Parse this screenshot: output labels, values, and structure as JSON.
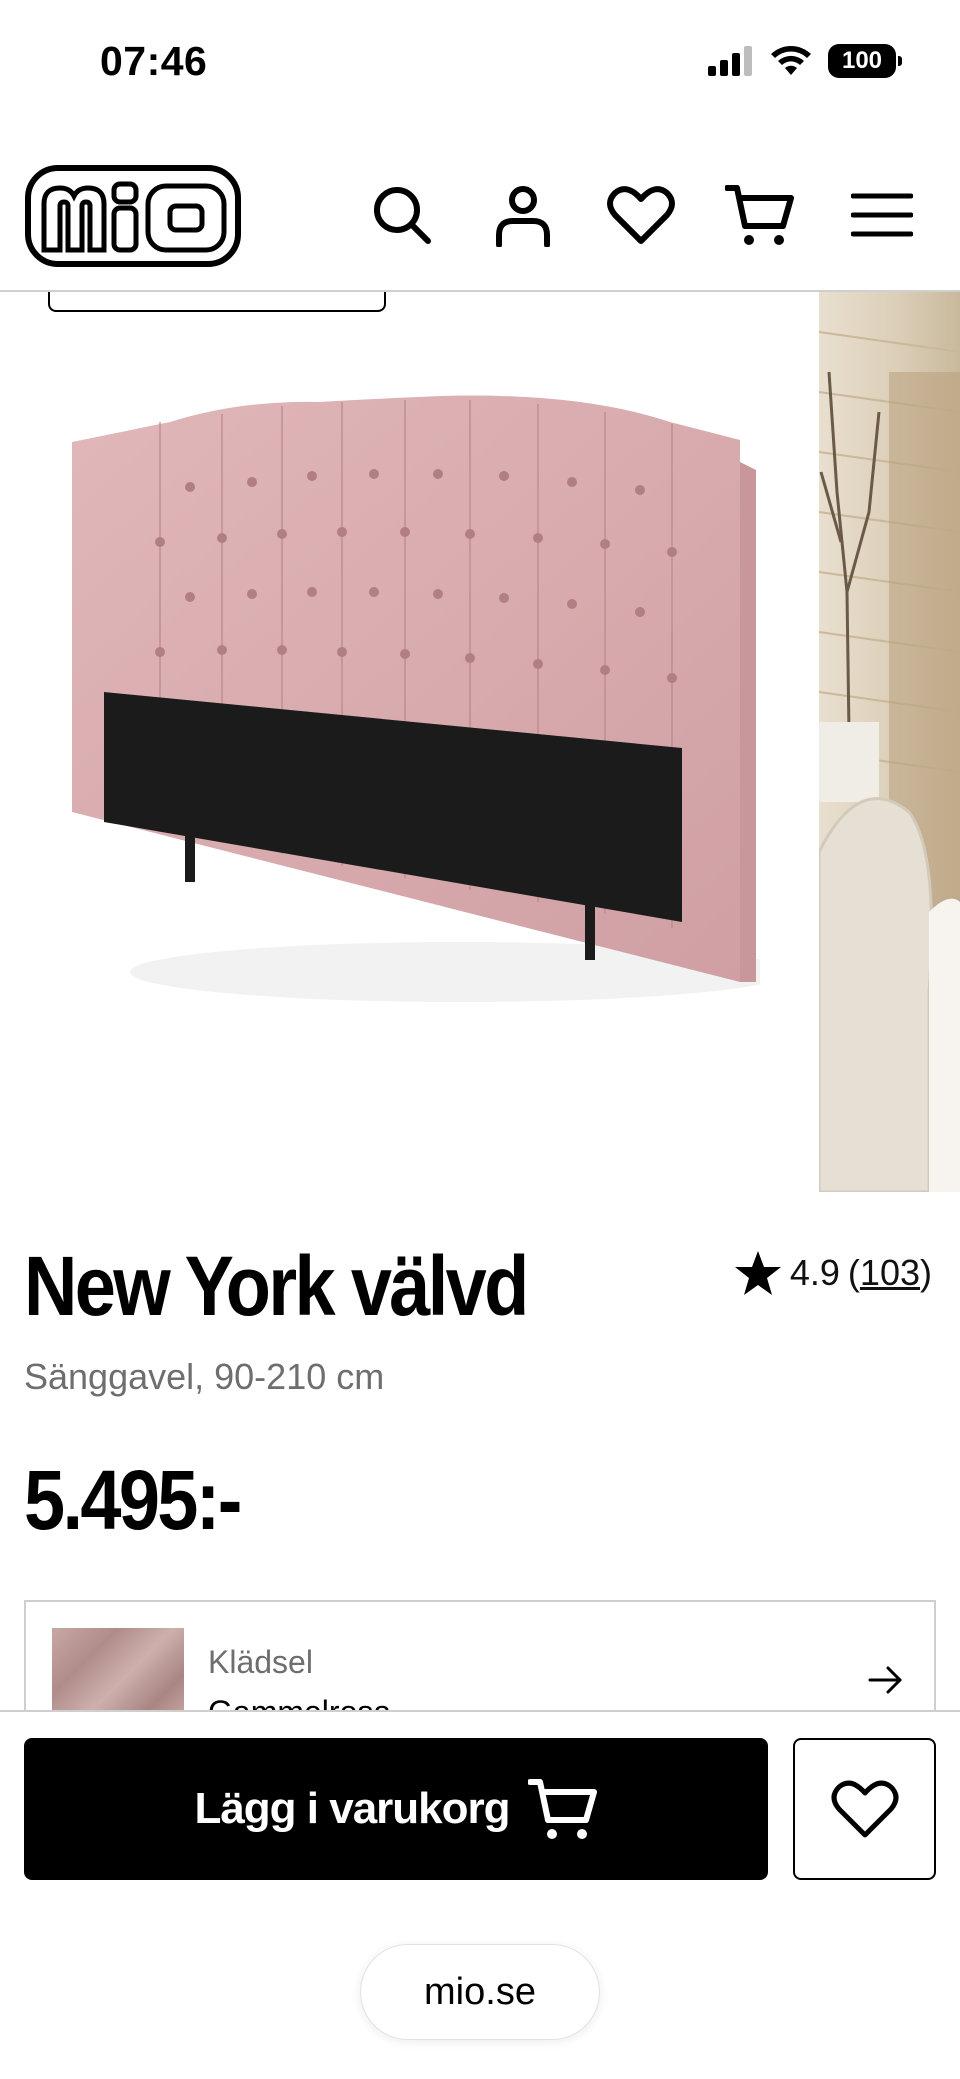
{
  "status_bar": {
    "time": "07:46",
    "battery": "100"
  },
  "header": {
    "logo_text": "mio",
    "icons": [
      "search-icon",
      "account-icon",
      "wishlist-icon",
      "cart-icon",
      "menu-icon"
    ]
  },
  "product": {
    "title": "New York välvd",
    "subtitle": "Sänggavel, 90-210 cm",
    "price": "5.495:-",
    "rating": {
      "score": "4.9",
      "open": "(",
      "count": "103",
      "close": ")"
    }
  },
  "option": {
    "label": "Klädsel",
    "value": "Gammelrosa"
  },
  "actions": {
    "add_to_cart": "Lägg i varukorg"
  },
  "browser": {
    "url": "mio.se"
  },
  "colors": {
    "accent": "#000000",
    "headboard": "#d9aeb0",
    "border": "#cfcfcf",
    "muted_text": "#6e6e6e"
  }
}
